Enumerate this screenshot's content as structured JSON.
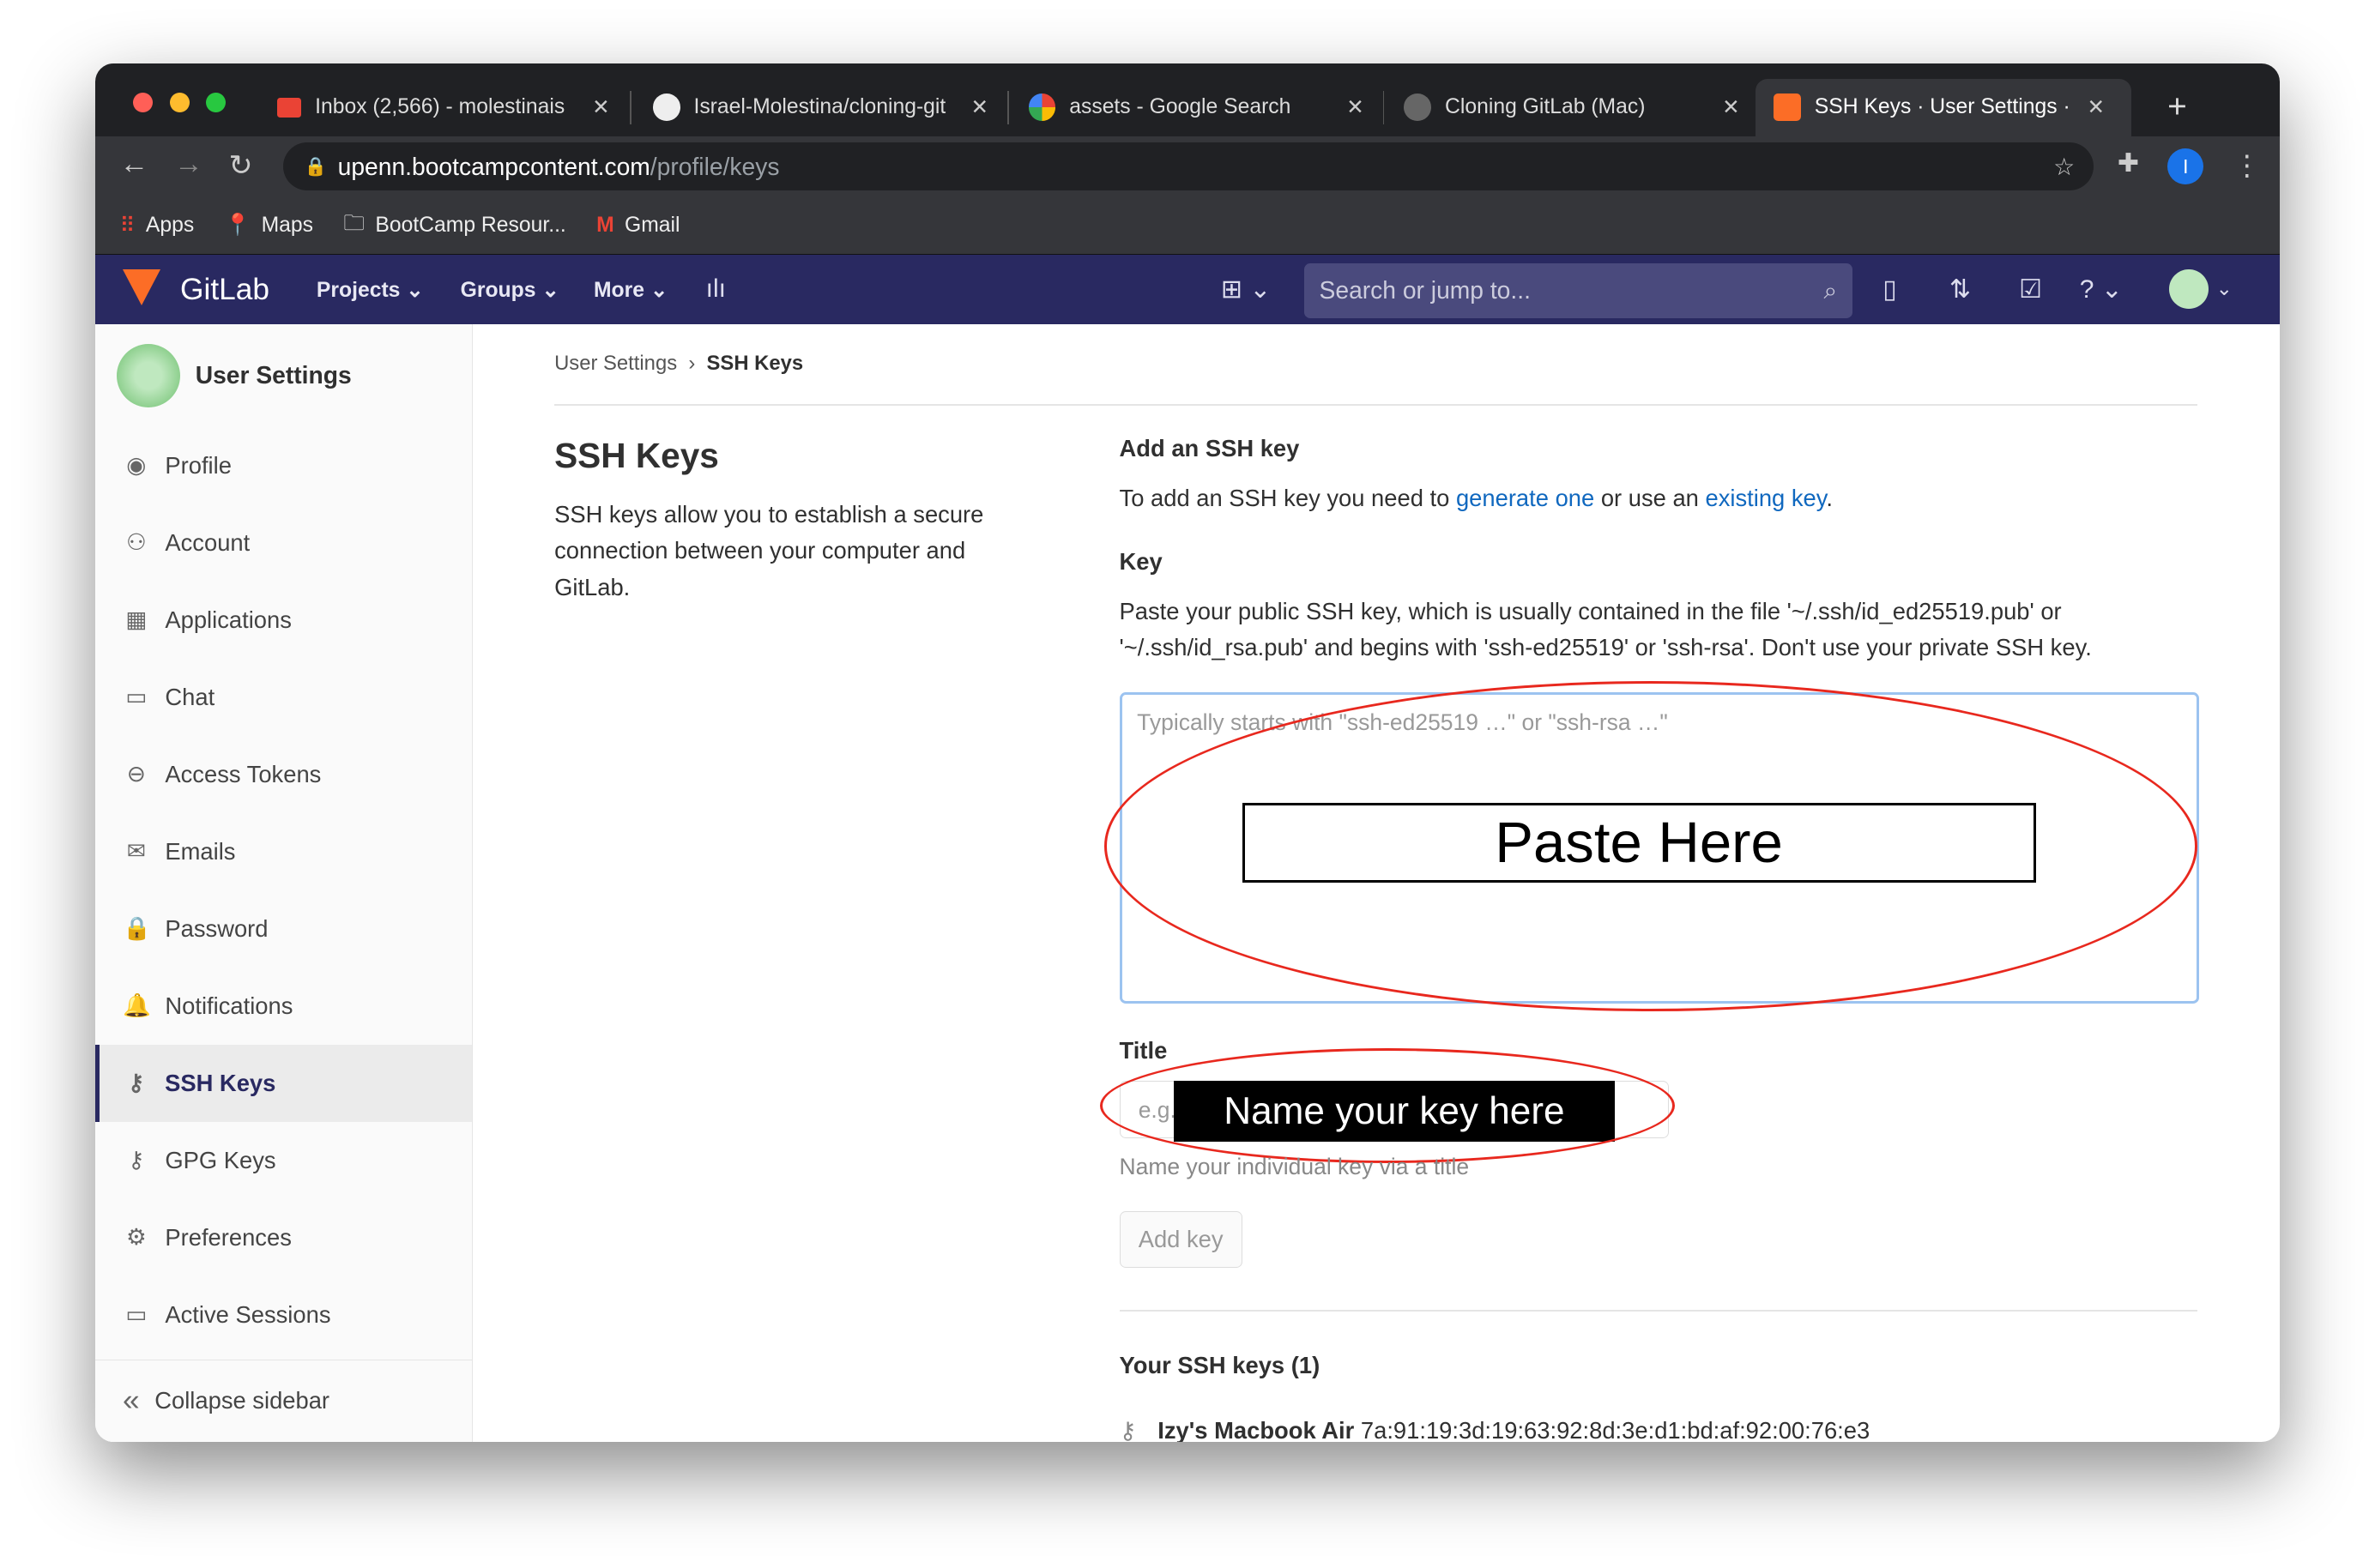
{
  "browser": {
    "tabs": [
      {
        "label": "Inbox (2,566) - molestinais",
        "icon": "gmail-icon"
      },
      {
        "label": "Israel-Molestina/cloning-git",
        "icon": "github-icon"
      },
      {
        "label": "assets - Google Search",
        "icon": "google-icon"
      },
      {
        "label": "Cloning GitLab (Mac)",
        "icon": "globe-icon"
      },
      {
        "label": "SSH Keys · User Settings · GitLab",
        "icon": "gitlab-icon"
      }
    ],
    "url_host": "upenn.bootcampcontent.com",
    "url_path": "/profile/keys",
    "profile_initial": "I",
    "bookmarks": [
      "Apps",
      "Maps",
      "BootCamp Resour...",
      "Gmail"
    ]
  },
  "gitlab": {
    "brand": "GitLab",
    "nav": [
      "Projects",
      "Groups",
      "More"
    ],
    "search_placeholder": "Search or jump to..."
  },
  "sidebar": {
    "title": "User Settings",
    "items": [
      {
        "label": "Profile",
        "icon": "◉"
      },
      {
        "label": "Account",
        "icon": "⚇"
      },
      {
        "label": "Applications",
        "icon": "▦"
      },
      {
        "label": "Chat",
        "icon": "▭"
      },
      {
        "label": "Access Tokens",
        "icon": "⊖"
      },
      {
        "label": "Emails",
        "icon": "✉"
      },
      {
        "label": "Password",
        "icon": "🔒"
      },
      {
        "label": "Notifications",
        "icon": "🔔"
      },
      {
        "label": "SSH Keys",
        "icon": "⚷"
      },
      {
        "label": "GPG Keys",
        "icon": "⚷"
      },
      {
        "label": "Preferences",
        "icon": "⚙"
      },
      {
        "label": "Active Sessions",
        "icon": "▭"
      }
    ],
    "collapse": "Collapse sidebar"
  },
  "main": {
    "breadcrumb": [
      "User Settings",
      "SSH Keys"
    ],
    "title": "SSH Keys",
    "description": "SSH keys allow you to establish a secure connection between your computer and GitLab.",
    "add_heading": "Add an SSH key",
    "add_text_1": "To add an SSH key you need to ",
    "generate_link": "generate one",
    "add_text_2": " or use an ",
    "existing_link": "existing key",
    "add_text_3": ".",
    "key_label": "Key",
    "key_help": "Paste your public SSH key, which is usually contained in the file '~/.ssh/id_ed25519.pub' or '~/.ssh/id_rsa.pub' and begins with 'ssh-ed25519' or 'ssh-rsa'. Don't use your private SSH key.",
    "key_placeholder": "Typically starts with \"ssh-ed25519 …\" or \"ssh-rsa …\"",
    "paste_annotation": "Paste Here",
    "title_label": "Title",
    "title_placeholder": "e.g. My MacBook key",
    "name_annotation": "Name your key here",
    "title_help": "Name your individual key via a title",
    "add_button": "Add key",
    "your_keys": "Your SSH keys (1)",
    "key_name": "Izy's Macbook Air",
    "key_fingerprint": "7a:91:19:3d:19:63:92:8d:3e:d1:bd:af:92:00:76:e3"
  }
}
